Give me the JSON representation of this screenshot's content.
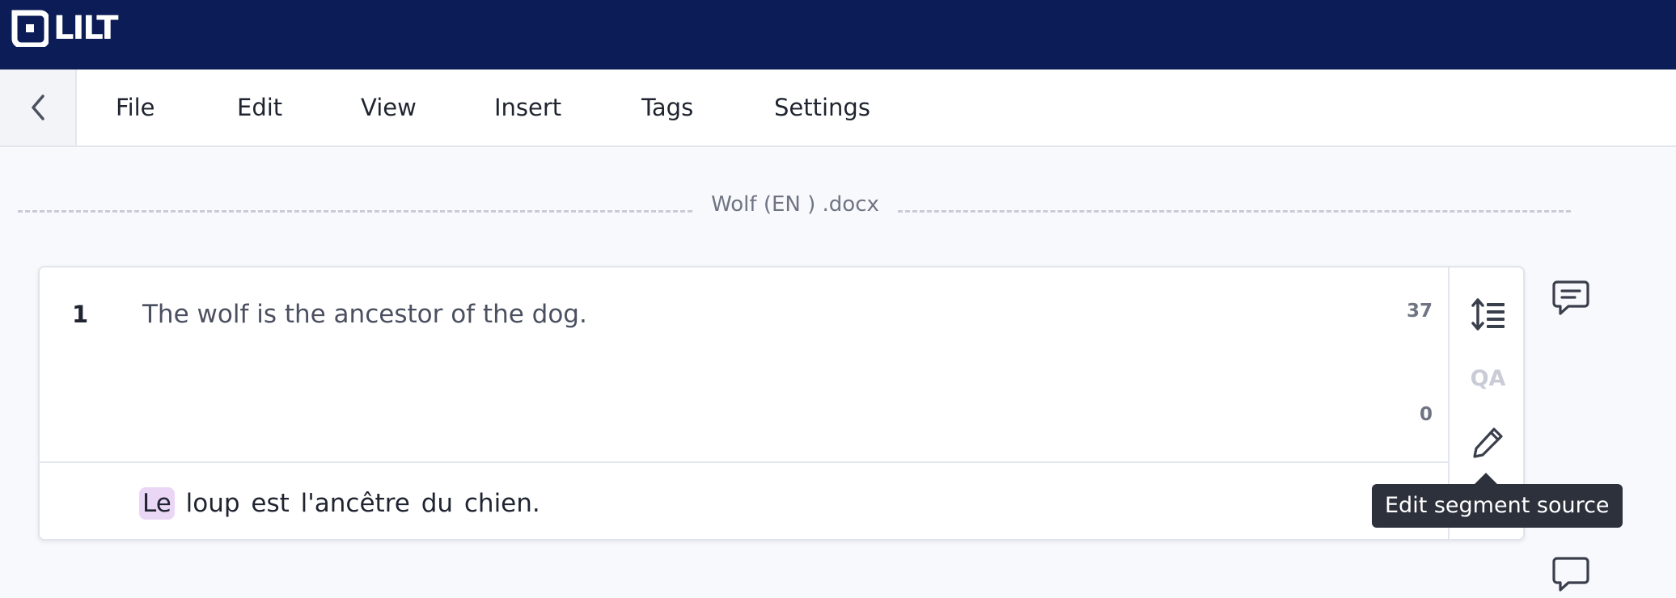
{
  "brand": {
    "logo_text": "LILT"
  },
  "menu": {
    "back_icon": "chevron-left-icon",
    "items": [
      {
        "label": "File"
      },
      {
        "label": "Edit"
      },
      {
        "label": "View"
      },
      {
        "label": "Insert"
      },
      {
        "label": "Tags"
      },
      {
        "label": "Settings"
      }
    ]
  },
  "document": {
    "file_name": "Wolf (EN ) .docx"
  },
  "segment": {
    "number": "1",
    "source_text": "The wolf is the ancestor of the dog.",
    "source_char_count": "37",
    "target_char_count": "0",
    "target_highlight": "Le",
    "target_rest": " loup est l'ancêtre du chien.",
    "actions": {
      "spacing_icon": "line-spacing-icon",
      "qa_label": "QA",
      "edit_icon": "pencil-icon",
      "comment_icon": "comment-icon"
    }
  },
  "tooltip": {
    "text": "Edit segment source"
  },
  "colors": {
    "topbar": "#0c1c56",
    "target_highlight": "#ead6f5",
    "tooltip_bg": "#2c313b"
  }
}
